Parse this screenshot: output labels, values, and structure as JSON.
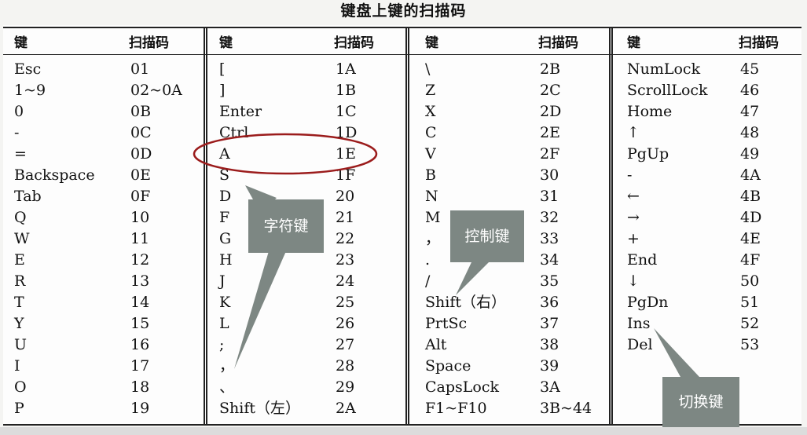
{
  "title": "键盘上键的扫描码",
  "headers": {
    "key": "键",
    "code": "扫描码"
  },
  "columns": [
    {
      "rows": [
        [
          "Esc",
          "01"
        ],
        [
          "1~9",
          "02~0A"
        ],
        [
          "0",
          "0B"
        ],
        [
          "-",
          "0C"
        ],
        [
          "=",
          "0D"
        ],
        [
          "Backspace",
          "0E"
        ],
        [
          "Tab",
          "0F"
        ],
        [
          "Q",
          "10"
        ],
        [
          "W",
          "11"
        ],
        [
          "E",
          "12"
        ],
        [
          "R",
          "13"
        ],
        [
          "T",
          "14"
        ],
        [
          "Y",
          "15"
        ],
        [
          "U",
          "16"
        ],
        [
          "I",
          "17"
        ],
        [
          "O",
          "18"
        ],
        [
          "P",
          "19"
        ]
      ]
    },
    {
      "rows": [
        [
          "[",
          "1A"
        ],
        [
          "]",
          "1B"
        ],
        [
          "Enter",
          "1C"
        ],
        [
          "Ctrl",
          "1D"
        ],
        [
          "A",
          "1E"
        ],
        [
          "S",
          "1F"
        ],
        [
          "D",
          "20"
        ],
        [
          "F",
          "21"
        ],
        [
          "G",
          "22"
        ],
        [
          "H",
          "23"
        ],
        [
          "J",
          "24"
        ],
        [
          "K",
          "25"
        ],
        [
          "L",
          "26"
        ],
        [
          ";",
          "27"
        ],
        [
          "，",
          "28"
        ],
        [
          "、",
          "29"
        ],
        [
          "Shift（左）",
          "2A"
        ]
      ]
    },
    {
      "rows": [
        [
          "\\",
          "2B"
        ],
        [
          "Z",
          "2C"
        ],
        [
          "X",
          "2D"
        ],
        [
          "C",
          "2E"
        ],
        [
          "V",
          "2F"
        ],
        [
          "B",
          "30"
        ],
        [
          "N",
          "31"
        ],
        [
          "M",
          "32"
        ],
        [
          "，",
          "33"
        ],
        [
          ".",
          "34"
        ],
        [
          "/",
          "35"
        ],
        [
          "Shift（右）",
          "36"
        ],
        [
          "PrtSc",
          "37"
        ],
        [
          "Alt",
          "38"
        ],
        [
          "Space",
          "39"
        ],
        [
          "CapsLock",
          "3A"
        ],
        [
          "F1~F10",
          "3B~44"
        ]
      ]
    },
    {
      "rows": [
        [
          "NumLock",
          "45"
        ],
        [
          "ScrollLock",
          "46"
        ],
        [
          "Home",
          "47"
        ],
        [
          "↑",
          "48"
        ],
        [
          "PgUp",
          "49"
        ],
        [
          "-",
          "4A"
        ],
        [
          "←",
          "4B"
        ],
        [
          "→",
          "4D"
        ],
        [
          "+",
          "4E"
        ],
        [
          "End",
          "4F"
        ],
        [
          "↓",
          "50"
        ],
        [
          "PgDn",
          "51"
        ],
        [
          "Ins",
          "52"
        ],
        [
          "Del",
          "53"
        ]
      ]
    }
  ],
  "callouts": {
    "char_keys": "字符键",
    "control_keys": "控制键",
    "toggle_keys": "切换键"
  },
  "colors": {
    "highlight_ellipse": "#9b1c1c",
    "callout_bg": "#7d8783"
  }
}
